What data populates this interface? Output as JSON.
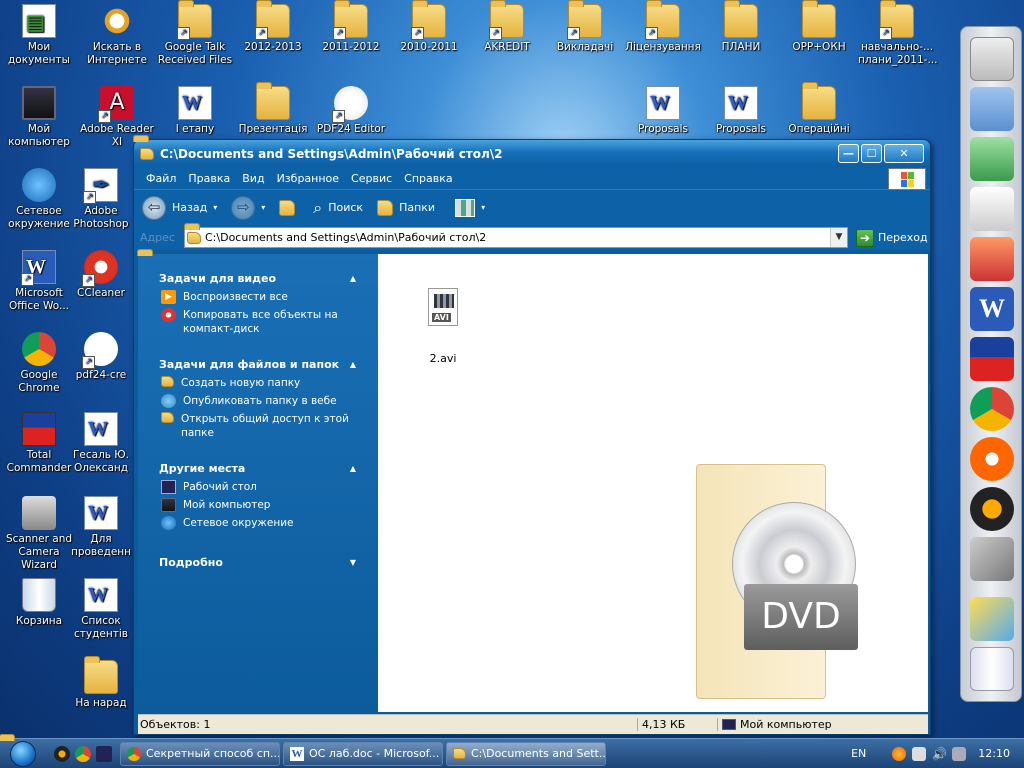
{
  "desktop": {
    "icons": [
      {
        "label": "Мои документы"
      },
      {
        "label": "Искать в Интернете"
      },
      {
        "label": "Google Talk Received Files"
      },
      {
        "label": "2012-2013"
      },
      {
        "label": "2011-2012"
      },
      {
        "label": "2010-2011"
      },
      {
        "label": "AKREDIT"
      },
      {
        "label": "Викладачі"
      },
      {
        "label": "Ліцензування"
      },
      {
        "label": "ПЛАНИ"
      },
      {
        "label": "ОРР+ОКН"
      },
      {
        "label": "навчально-... плани_2011-..."
      },
      {
        "label": "Мой компьютер"
      },
      {
        "label": "Adobe Reader XI"
      },
      {
        "label": "I етапу"
      },
      {
        "label": "Презентація"
      },
      {
        "label": "PDF24 Editor"
      },
      {
        "label": "Proposals"
      },
      {
        "label": "Proposals"
      },
      {
        "label": "Операційні"
      },
      {
        "label": "Сетевое окружение"
      },
      {
        "label": "Adobe Photoshop"
      },
      {
        "label": "Microsoft Office Wo..."
      },
      {
        "label": "CCleaner"
      },
      {
        "label": "Google Chrome"
      },
      {
        "label": "pdf24-cre"
      },
      {
        "label": "Total Commander"
      },
      {
        "label": "Гесаль Ю. Олександ"
      },
      {
        "label": "Scanner and Camera Wizard"
      },
      {
        "label": "Для проведенн"
      },
      {
        "label": "Корзина"
      },
      {
        "label": "Список студентів"
      },
      {
        "label": "На нарад"
      }
    ]
  },
  "window": {
    "title": "C:\\Documents and Settings\\Admin\\Рабочий стол\\2",
    "controls": {
      "minimize": "—",
      "maximize": "☐",
      "close": "✕"
    },
    "menu": [
      "Файл",
      "Правка",
      "Вид",
      "Избранное",
      "Сервис",
      "Справка"
    ],
    "toolbar": {
      "back": "Назад",
      "search": "Поиск",
      "folders": "Папки"
    },
    "address": {
      "label": "Адрес",
      "value": "C:\\Documents and Settings\\Admin\\Рабочий стол\\2",
      "go": "Переход"
    },
    "taskpane": {
      "groups": [
        {
          "title": "Задачи для видео",
          "items": [
            "Воспроизвести все",
            "Копировать все объекты на компакт-диск"
          ]
        },
        {
          "title": "Задачи для файлов и папок",
          "items": [
            "Создать новую папку",
            "Опубликовать папку в вебе",
            "Открыть общий доступ к этой папке"
          ]
        },
        {
          "title": "Другие места",
          "items": [
            "Рабочий стол",
            "Мой компьютер",
            "Сетевое окружение"
          ]
        },
        {
          "title": "Подробно",
          "items": []
        }
      ]
    },
    "files": [
      {
        "name": "2.avi",
        "badge": "AVI"
      }
    ],
    "watermark": {
      "text": "DVD"
    },
    "status": {
      "objects": "Объектов: 1",
      "size": "4,13 КБ",
      "location": "Мой компьютер"
    }
  },
  "taskbar": {
    "tasks": [
      {
        "label": "Секретный способ сп..."
      },
      {
        "label": "ОС лаб.doc - Microsof..."
      },
      {
        "label": "C:\\Documents and Sett..."
      }
    ],
    "tray": {
      "lang": "EN",
      "time": "12:10"
    }
  },
  "colors": {
    "titlebar": "#1670b9",
    "taskpane": "#0c5c9c",
    "statusbar": "#ece9d8"
  }
}
